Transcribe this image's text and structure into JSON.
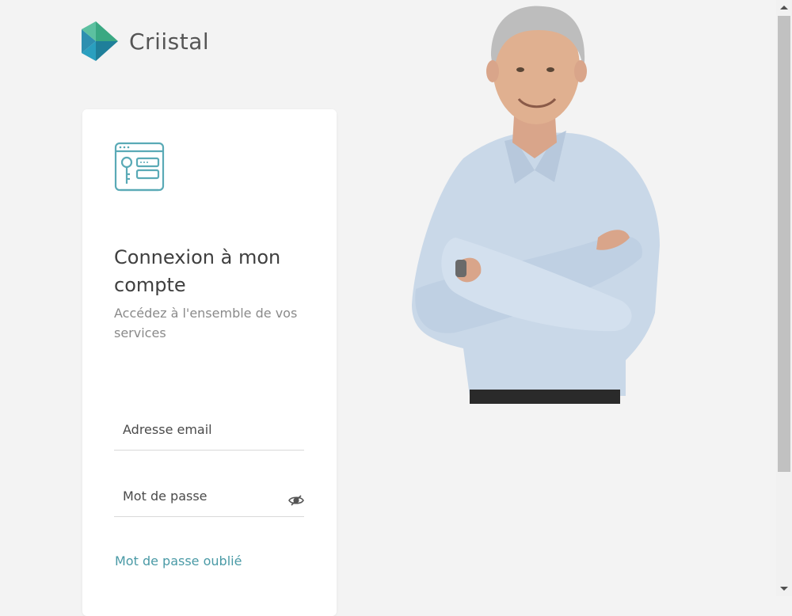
{
  "brand": {
    "name": "Criistal",
    "colors": {
      "green": "#5cc0a0",
      "blue": "#2e8fb0",
      "teal": "#1f7f9a"
    }
  },
  "login": {
    "icon": "browser-key-icon",
    "title": "Connexion à mon compte",
    "subtitle": "Accédez à l'ensemble de vos services",
    "email_placeholder": "Adresse email",
    "password_placeholder": "Mot de passe",
    "toggle_icon": "eye-slash-icon",
    "forgot_password": "Mot de passe oublié",
    "accent_color": "#4a9aa6"
  },
  "hero": {
    "image": "smiling-man-arms-crossed"
  }
}
